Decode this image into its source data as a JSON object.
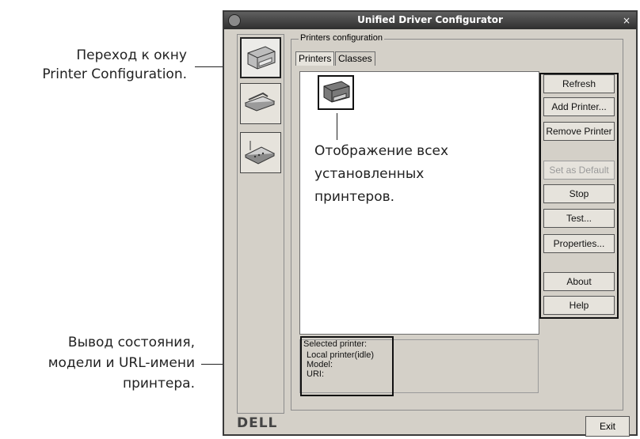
{
  "callouts": {
    "top": [
      "Переход к окну",
      "Printer Configuration."
    ],
    "bottom": [
      "Вывод состояния,",
      "модели и URL-имени",
      "принтера."
    ],
    "middle": [
      "Отображение всех",
      "установленных",
      "принтеров."
    ]
  },
  "window": {
    "title": "Unified Driver Configurator",
    "close_glyph": "×",
    "group_label": "Printers configuration",
    "tabs": [
      "Printers",
      "Classes"
    ],
    "buttons": {
      "refresh": "Refresh",
      "add_printer": "Add Printer...",
      "remove_printer": "Remove Printer",
      "set_default": "Set as Default",
      "stop": "Stop",
      "test": "Test...",
      "properties": "Properties...",
      "about": "About",
      "help": "Help"
    },
    "status": {
      "heading": "Selected printer:",
      "printer": "Local printer(idle)",
      "model": "Model:",
      "uri": "URI:"
    },
    "logo": "DELL",
    "exit": "Exit"
  },
  "icons": [
    "printer-icon",
    "scanner-icon",
    "port-icon",
    "printer-device-icon"
  ]
}
